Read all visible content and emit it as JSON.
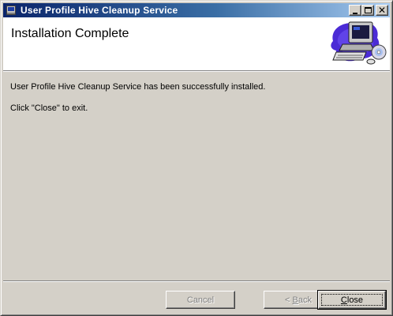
{
  "window": {
    "title": "User Profile Hive Cleanup Service",
    "icon": "installer-app-icon",
    "controls": [
      "minimize-icon",
      "maximize-icon",
      "close-icon"
    ]
  },
  "banner": {
    "title": "Installation Complete",
    "art": "computer-cd-icon"
  },
  "body": {
    "message": "User Profile Hive Cleanup Service has been successfully installed.",
    "instruction": "Click \"Close\" to exit."
  },
  "buttons": {
    "cancel": {
      "label": "Cancel",
      "enabled": false
    },
    "back": {
      "prefix": "< ",
      "mnemonic": "B",
      "rest": "ack",
      "enabled": false
    },
    "close": {
      "mnemonic": "C",
      "rest": "lose",
      "enabled": true,
      "default": true
    }
  },
  "colors": {
    "title_gradient_start": "#0a246a",
    "title_gradient_end": "#a6caf0",
    "face": "#d4d0c8",
    "banner_bg": "#ffffff"
  }
}
